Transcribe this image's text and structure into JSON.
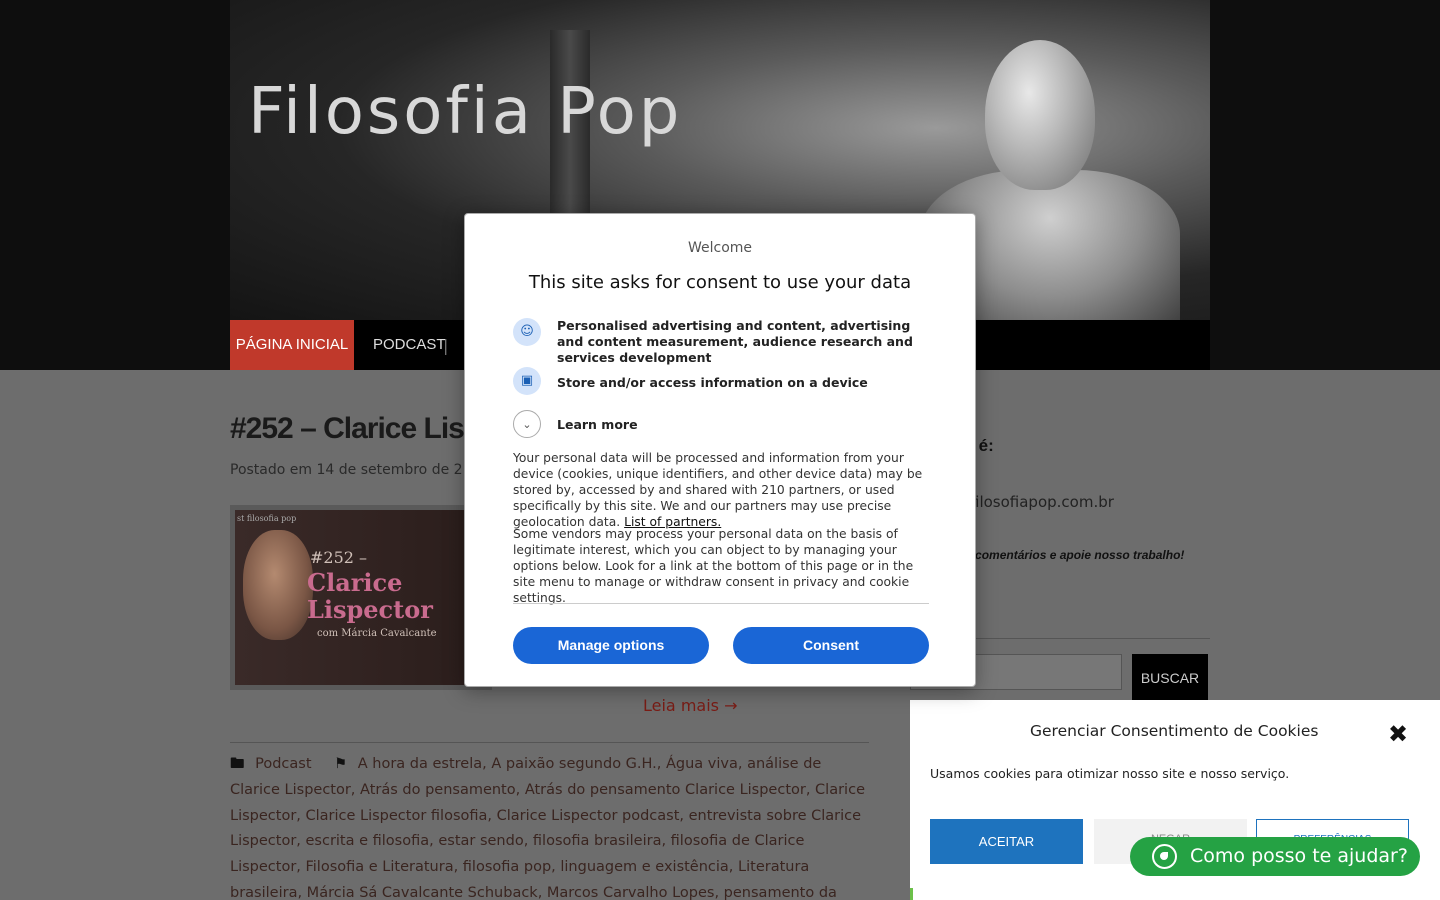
{
  "site": {
    "title": "Filosofia Pop"
  },
  "nav": {
    "home": "PÁGINA INICIAL",
    "podcast": "PODCAST",
    "separator": "|"
  },
  "post": {
    "title": "#252 – Clarice Lispec",
    "meta": "Postado em 14 de setembro de 2",
    "thumb": {
      "small": "st filosofia pop",
      "num": "#252 –",
      "name1": "Clarice",
      "name2": "Lispector",
      "sub": "com Márcia Cavalcante"
    },
    "read_more": "Leia mais →",
    "category": "Podcast",
    "tags": "A hora da estrela, A paixão segundo G.H., Água viva, análise de Clarice Lispector, Atrás do pensamento, Atrás do pensamento Clarice Lispector, Clarice Lispector, Clarice Lispector filosofia, Clarice Lispector podcast, entrevista sobre Clarice Lispector, escrita e filosofia, estar sendo, filosofia brasileira, filosofia de Clarice Lispector, Filosofia e Literatura, filosofia pop, linguagem e existência, Literatura brasileira, Márcia Sá Cavalcante Schuback, Marcos Carvalho Lopes, pensamento da"
  },
  "sidebar": {
    "email_label": "ail é:",
    "email": "@filosofiapop.com.br",
    "note": "es, comentários e apoie nosso trabalho!",
    "search_button": "BUSCAR"
  },
  "cookie_panel": {
    "title": "Gerenciar Consentimento de Cookies",
    "text": "Usamos cookies para otimizar nosso site e nosso serviço.",
    "accept": "ACEITAR",
    "deny": "NEGAR",
    "preferences": "PREFERÊNCIAS"
  },
  "whatsapp": {
    "label": "Como posso te ajudar?"
  },
  "consent_modal": {
    "welcome": "Welcome",
    "heading": "This site asks for consent to use your data",
    "purpose1": "Personalised advertising and content, advertising and content measurement, audience research and services development",
    "purpose2": "Store and/or access information on a device",
    "learn_more": "Learn more",
    "paragraph1": "Your personal data will be processed and information from your device (cookies, unique identifiers, and other device data) may be stored by, accessed by and shared with 210 partners, or used specifically by this site. We and our partners may use precise geolocation data.",
    "partners_link": "List of partners.",
    "paragraph2": "Some vendors may process your personal data on the basis of legitimate interest, which you can object to by managing your options below. Look for a link at the bottom of this page or in the site menu to manage or withdraw consent in privacy and cookie settings.",
    "manage_button": "Manage options",
    "consent_button": "Consent"
  },
  "colors": {
    "nav_active": "#c0392b",
    "modal_button": "#1a66d6",
    "cookie_accept": "#1e73be",
    "whatsapp": "#25a244"
  },
  "icons": [
    "user-icon",
    "devices-icon",
    "chevron-down-icon",
    "folder-icon",
    "tags-icon",
    "close-icon",
    "whatsapp-icon"
  ]
}
